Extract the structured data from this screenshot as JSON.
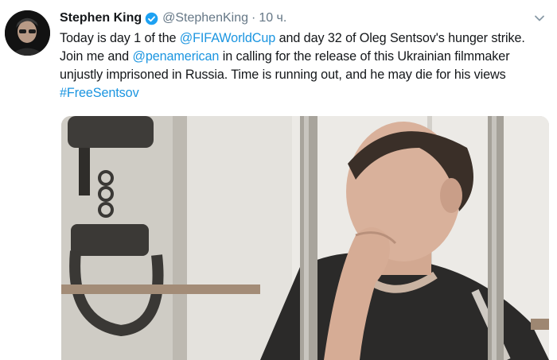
{
  "tweet": {
    "author_name": "Stephen King",
    "handle": "@StephenKing",
    "separator": "·",
    "time": "10 ч.",
    "text": {
      "l1_a": "Today is day 1 of the ",
      "l1_link": "@FIFAWorldCup",
      "l1_b": " and day 32 of Oleg Sentsov's hunger strike.",
      "l2_a": "Join me and ",
      "l2_link": "@penamerican",
      "l2_b": " in calling for the release of this Ukrainian filmmaker",
      "l3": "unjustly imprisoned in Russia. Time is running out, and he may die for his views",
      "l4_link": "#FreeSentsov"
    }
  },
  "icons": {
    "verified": "verified-badge-icon",
    "caret": "chevron-down-icon"
  },
  "colors": {
    "link": "#1b95e0",
    "secondary_text": "#657786",
    "verified": "#1da1f2"
  }
}
